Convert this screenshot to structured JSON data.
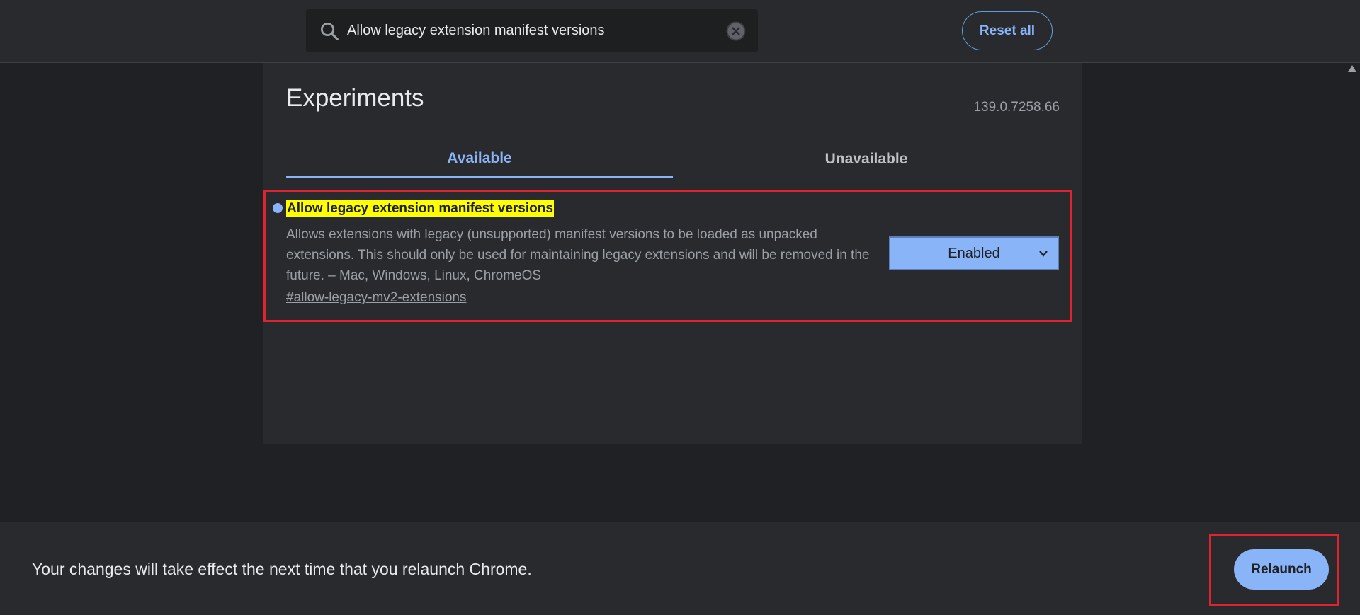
{
  "search": {
    "value": "Allow legacy extension manifest versions",
    "icon": "search-icon",
    "clear_icon": "close-circle-icon"
  },
  "header": {
    "reset_label": "Reset all"
  },
  "main": {
    "title": "Experiments",
    "version": "139.0.7258.66",
    "tabs": [
      {
        "label": "Available",
        "active": true
      },
      {
        "label": "Unavailable",
        "active": false
      }
    ]
  },
  "flag": {
    "title": "Allow legacy extension manifest versions",
    "description": "Allows extensions with legacy (unsupported) manifest versions to be loaded as unpacked extensions. This should only be used for maintaining legacy extensions and will be removed in the future. – Mac, Windows, Linux, ChromeOS",
    "link": "#allow-legacy-mv2-extensions",
    "selected_value": "Enabled"
  },
  "footer": {
    "message": "Your changes will take effect the next time that you relaunch Chrome.",
    "relaunch_label": "Relaunch"
  },
  "colors": {
    "accent": "#8ab4f8",
    "highlight": "#ffff00",
    "annotation_red": "#e0232e",
    "background": "#202124",
    "surface": "#292a2d"
  }
}
